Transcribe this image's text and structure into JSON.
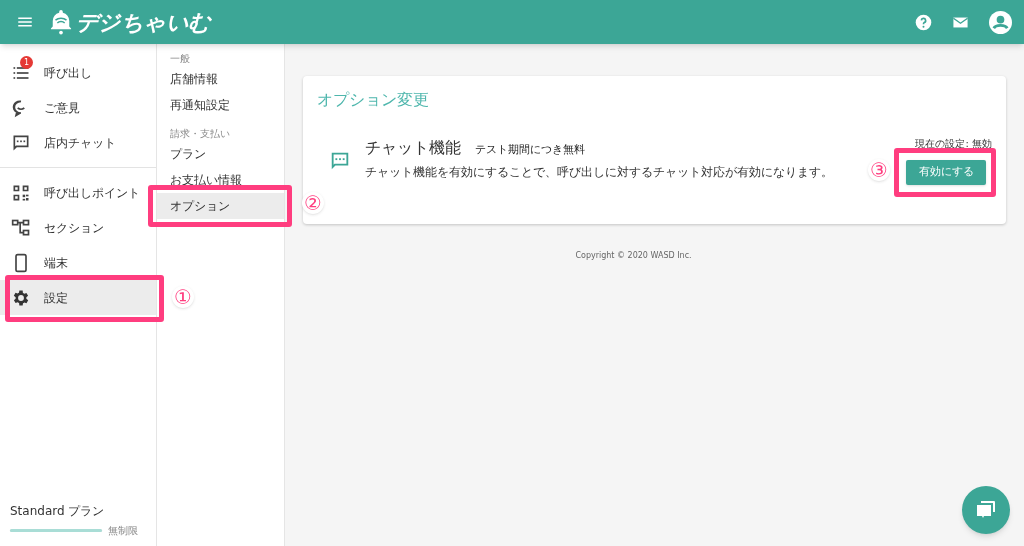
{
  "header": {
    "logo": "デジちゃいむ"
  },
  "nav": {
    "groups": [
      {
        "items": [
          {
            "label": "呼び出し",
            "badge": "1",
            "selected": false
          },
          {
            "label": "ご意見",
            "selected": false
          },
          {
            "label": "店内チャット",
            "selected": false
          }
        ]
      },
      {
        "items": [
          {
            "label": "呼び出しポイント",
            "selected": false
          },
          {
            "label": "セクション",
            "selected": false
          },
          {
            "label": "端末",
            "selected": false
          },
          {
            "label": "設定",
            "selected": true,
            "annotation": "①"
          }
        ]
      }
    ]
  },
  "plan": {
    "name": "Standard プラン",
    "level": 1,
    "limit": "無制限"
  },
  "subnav": {
    "groups": [
      {
        "heading": "一般",
        "items": [
          {
            "label": "店舗情報",
            "selected": false
          },
          {
            "label": "再通知設定",
            "selected": false
          }
        ]
      },
      {
        "heading": "請求・支払い",
        "items": [
          {
            "label": "プラン",
            "selected": false
          },
          {
            "label": "お支払い情報",
            "selected": false
          },
          {
            "label": "オプション",
            "selected": true,
            "annotation": "②"
          }
        ]
      }
    ]
  },
  "card": {
    "title": "オプション変更",
    "option": {
      "name": "チャット機能",
      "note": "テスト期間につき無料",
      "description": "チャット機能を有効にすることで、呼び出しに対するチャット対応が有効になります。",
      "current": "現在の設定: 無効",
      "button": "有効にする",
      "annotation": "③"
    }
  },
  "footer": "Copyright © 2020 WASD Inc."
}
